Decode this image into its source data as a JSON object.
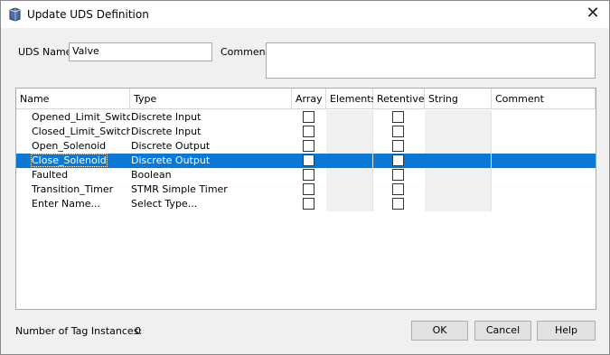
{
  "window": {
    "title": "Update UDS Definition",
    "close_glyph": "✕",
    "icon": "uds-app-icon"
  },
  "form": {
    "uds_name_label": "UDS Name",
    "uds_name_value": "Valve",
    "comment_label": "Comment",
    "comment_value": ""
  },
  "table": {
    "columns": [
      "Name",
      "Type",
      "Array",
      "Elements",
      "Retentive",
      "String Length",
      "Comment"
    ],
    "rows": [
      {
        "name": "Opened_Limit_Switch",
        "type": "Discrete Input",
        "array": false,
        "retentive": false,
        "selected": false
      },
      {
        "name": "Closed_Limit_Switch",
        "type": "Discrete Input",
        "array": false,
        "retentive": false,
        "selected": false
      },
      {
        "name": "Open_Solenoid",
        "type": "Discrete Output",
        "array": false,
        "retentive": false,
        "selected": false
      },
      {
        "name": "Close_Solenoid",
        "type": "Discrete Output",
        "array": false,
        "retentive": false,
        "selected": true
      },
      {
        "name": "Faulted",
        "type": "Boolean",
        "array": false,
        "retentive": false,
        "selected": false
      },
      {
        "name": "Transition_Timer",
        "type": "STMR  Simple Timer",
        "array": false,
        "retentive": false,
        "selected": false
      },
      {
        "name": "Enter Name...",
        "type": "Select Type...",
        "array": false,
        "retentive": false,
        "selected": false
      }
    ]
  },
  "footer": {
    "instances_label": "Number of Tag Instances:",
    "instances_value": "0",
    "ok": "OK",
    "cancel": "Cancel",
    "help": "Help"
  },
  "colors": {
    "selection": "#0a78d7",
    "dialog_bg": "#f0f0f0"
  }
}
